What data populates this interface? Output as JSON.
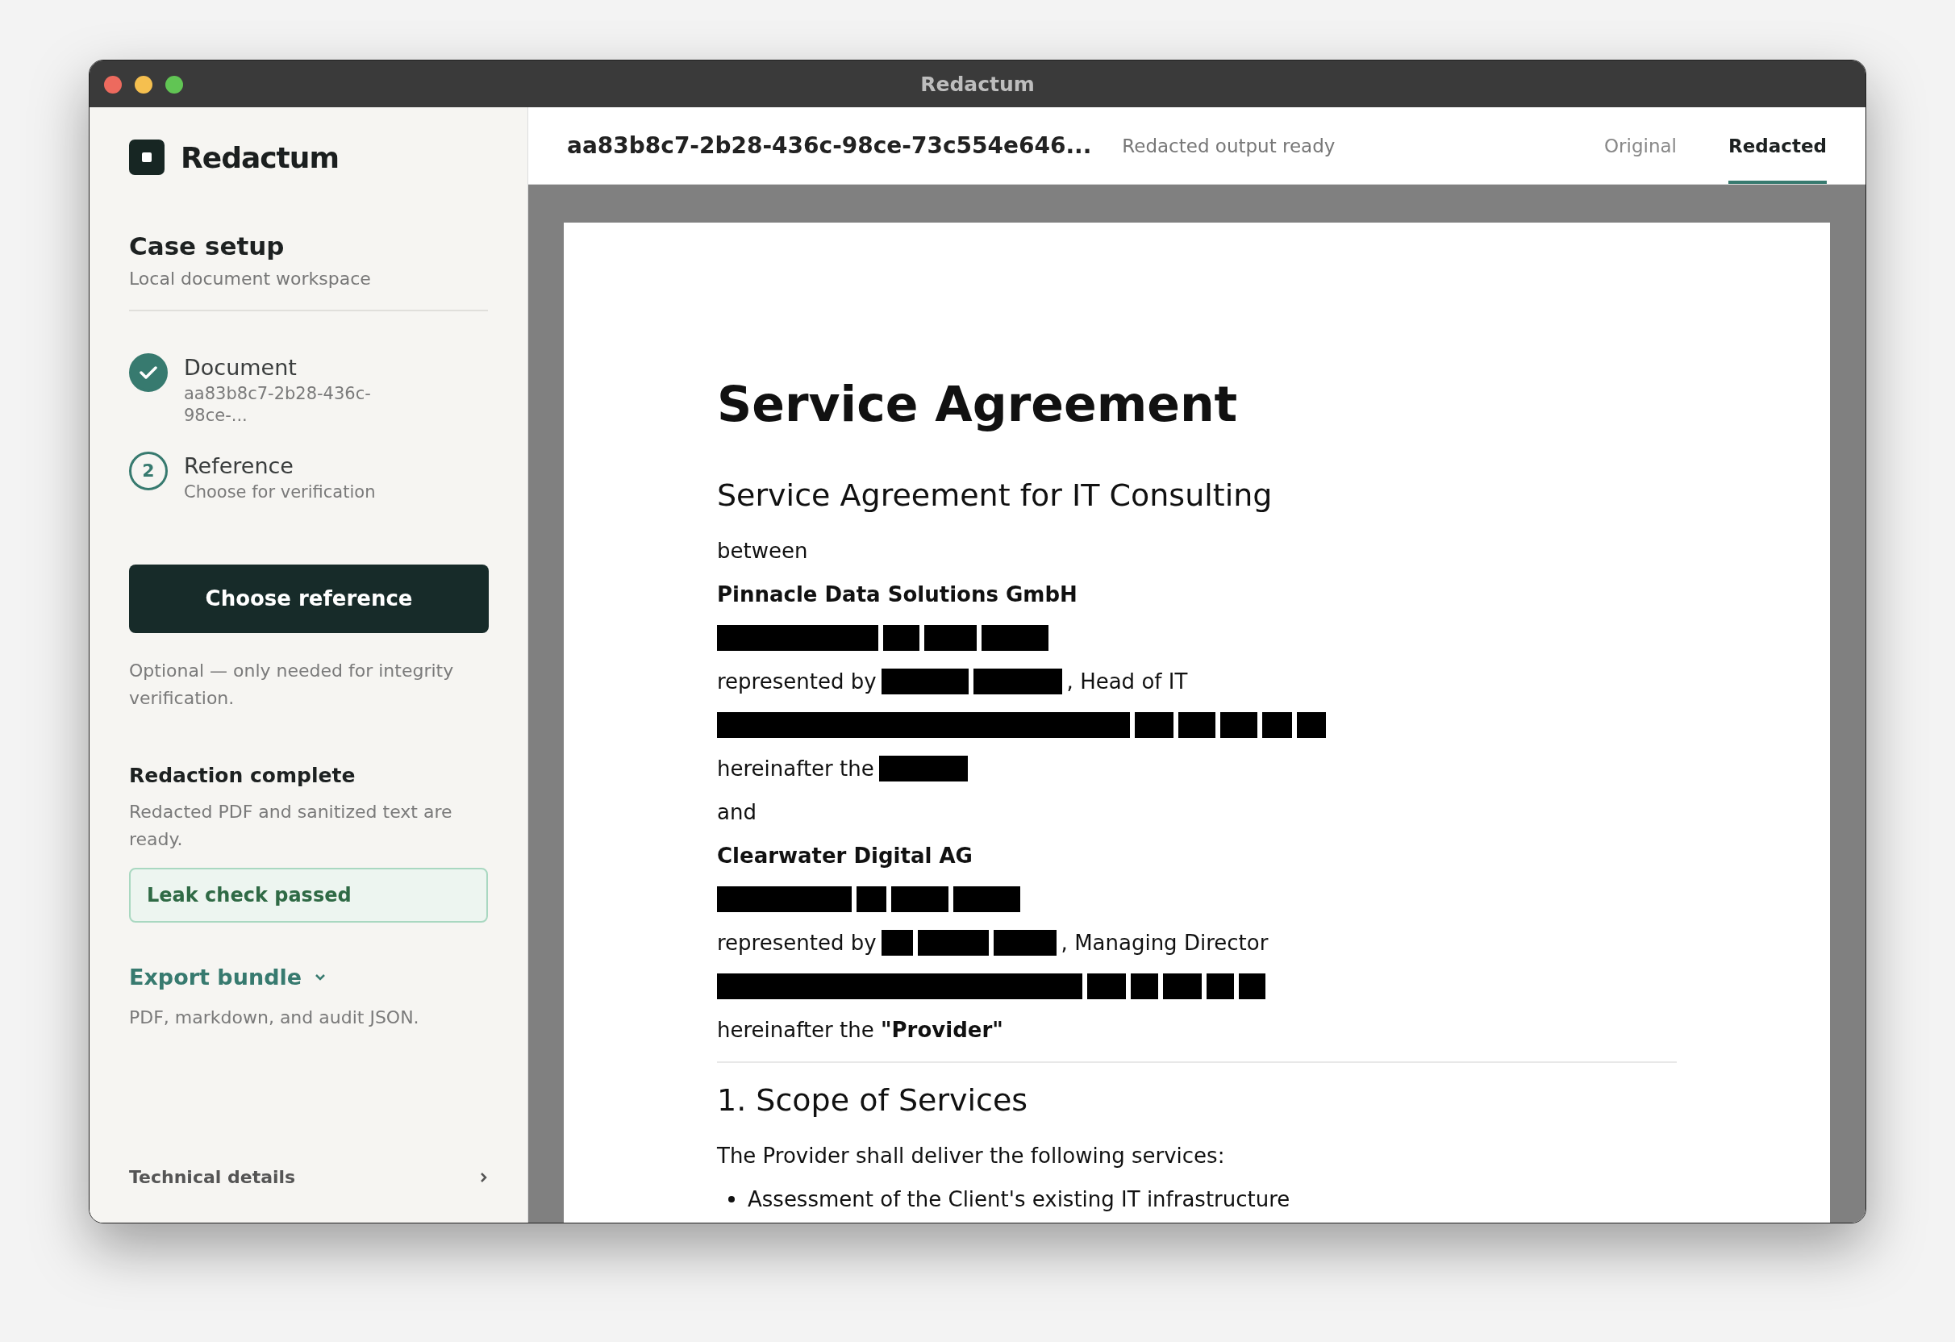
{
  "window": {
    "title": "Redactum"
  },
  "sidebar": {
    "brand": "Redactum",
    "heading": "Case setup",
    "subheading": "Local document workspace",
    "steps": [
      {
        "title": "Document",
        "subtitle": "aa83b8c7-2b28-436c-98ce-...",
        "completed": true
      },
      {
        "title": "Reference",
        "subtitle": "Choose for verification",
        "completed": false,
        "number": "2"
      }
    ],
    "primary_button": "Choose reference",
    "note": "Optional — only needed for integrity verification.",
    "result_title": "Redaction complete",
    "result_text": "Redacted PDF and sanitized text are ready.",
    "badge": "Leak check passed",
    "export_link": "Export bundle",
    "export_note": "PDF, markdown, and audit JSON.",
    "footer_link": "Technical details"
  },
  "header": {
    "file_name": "aa83b8c7-2b28-436c-98ce-73c554e646...",
    "status": "Redacted output ready",
    "tabs": [
      {
        "label": "Original",
        "selected": false
      },
      {
        "label": "Redacted",
        "selected": true
      }
    ]
  },
  "document": [
    {
      "kind": "h1",
      "text": "Service Agreement"
    },
    {
      "kind": "h2",
      "text": "Service Agreement for IT Consulting"
    },
    {
      "kind": "p",
      "segments": [
        {
          "kind": "text",
          "text": "between"
        }
      ]
    },
    {
      "kind": "strong",
      "text": "Pinnacle Data Solutions GmbH"
    },
    {
      "kind": "p",
      "segments": [
        {
          "kind": "redaction"
        },
        {
          "kind": "redaction"
        },
        {
          "kind": "redaction"
        },
        {
          "kind": "redaction"
        }
      ]
    },
    {
      "kind": "p",
      "segments": [
        {
          "kind": "text",
          "text": "represented by"
        },
        {
          "kind": "redaction"
        },
        {
          "kind": "redaction"
        },
        {
          "kind": "text",
          "text": ", Head of IT"
        }
      ]
    },
    {
      "kind": "p",
      "segments": [
        {
          "kind": "redaction"
        },
        {
          "kind": "redaction"
        },
        {
          "kind": "redaction"
        },
        {
          "kind": "redaction"
        },
        {
          "kind": "redaction"
        },
        {
          "kind": "redaction"
        }
      ]
    },
    {
      "kind": "p",
      "segments": [
        {
          "kind": "text",
          "text": "hereinafter the"
        },
        {
          "kind": "redaction"
        }
      ]
    },
    {
      "kind": "p",
      "segments": [
        {
          "kind": "text",
          "text": "and"
        }
      ]
    },
    {
      "kind": "strong",
      "text": "Clearwater Digital AG"
    },
    {
      "kind": "p",
      "segments": [
        {
          "kind": "redaction"
        },
        {
          "kind": "redaction"
        },
        {
          "kind": "redaction"
        },
        {
          "kind": "redaction"
        }
      ]
    },
    {
      "kind": "p",
      "segments": [
        {
          "kind": "text",
          "text": "represented by"
        },
        {
          "kind": "redaction"
        },
        {
          "kind": "redaction"
        },
        {
          "kind": "redaction"
        },
        {
          "kind": "text",
          "text": ", Managing Director"
        }
      ]
    },
    {
      "kind": "p",
      "segments": [
        {
          "kind": "redaction"
        },
        {
          "kind": "redaction"
        },
        {
          "kind": "redaction"
        },
        {
          "kind": "redaction"
        },
        {
          "kind": "redaction"
        },
        {
          "kind": "redaction"
        }
      ]
    },
    {
      "kind": "p",
      "segments": [
        {
          "kind": "text",
          "text": "hereinafter the **\"Provider\"**"
        }
      ]
    },
    {
      "kind": "rule"
    },
    {
      "kind": "h2",
      "text": "1. Scope of Services"
    },
    {
      "kind": "p",
      "segments": [
        {
          "kind": "text",
          "text": "The Provider shall deliver the following services:"
        }
      ]
    },
    {
      "kind": "bullet",
      "text": "Assessment of the Client's existing IT infrastructure"
    }
  ]
}
